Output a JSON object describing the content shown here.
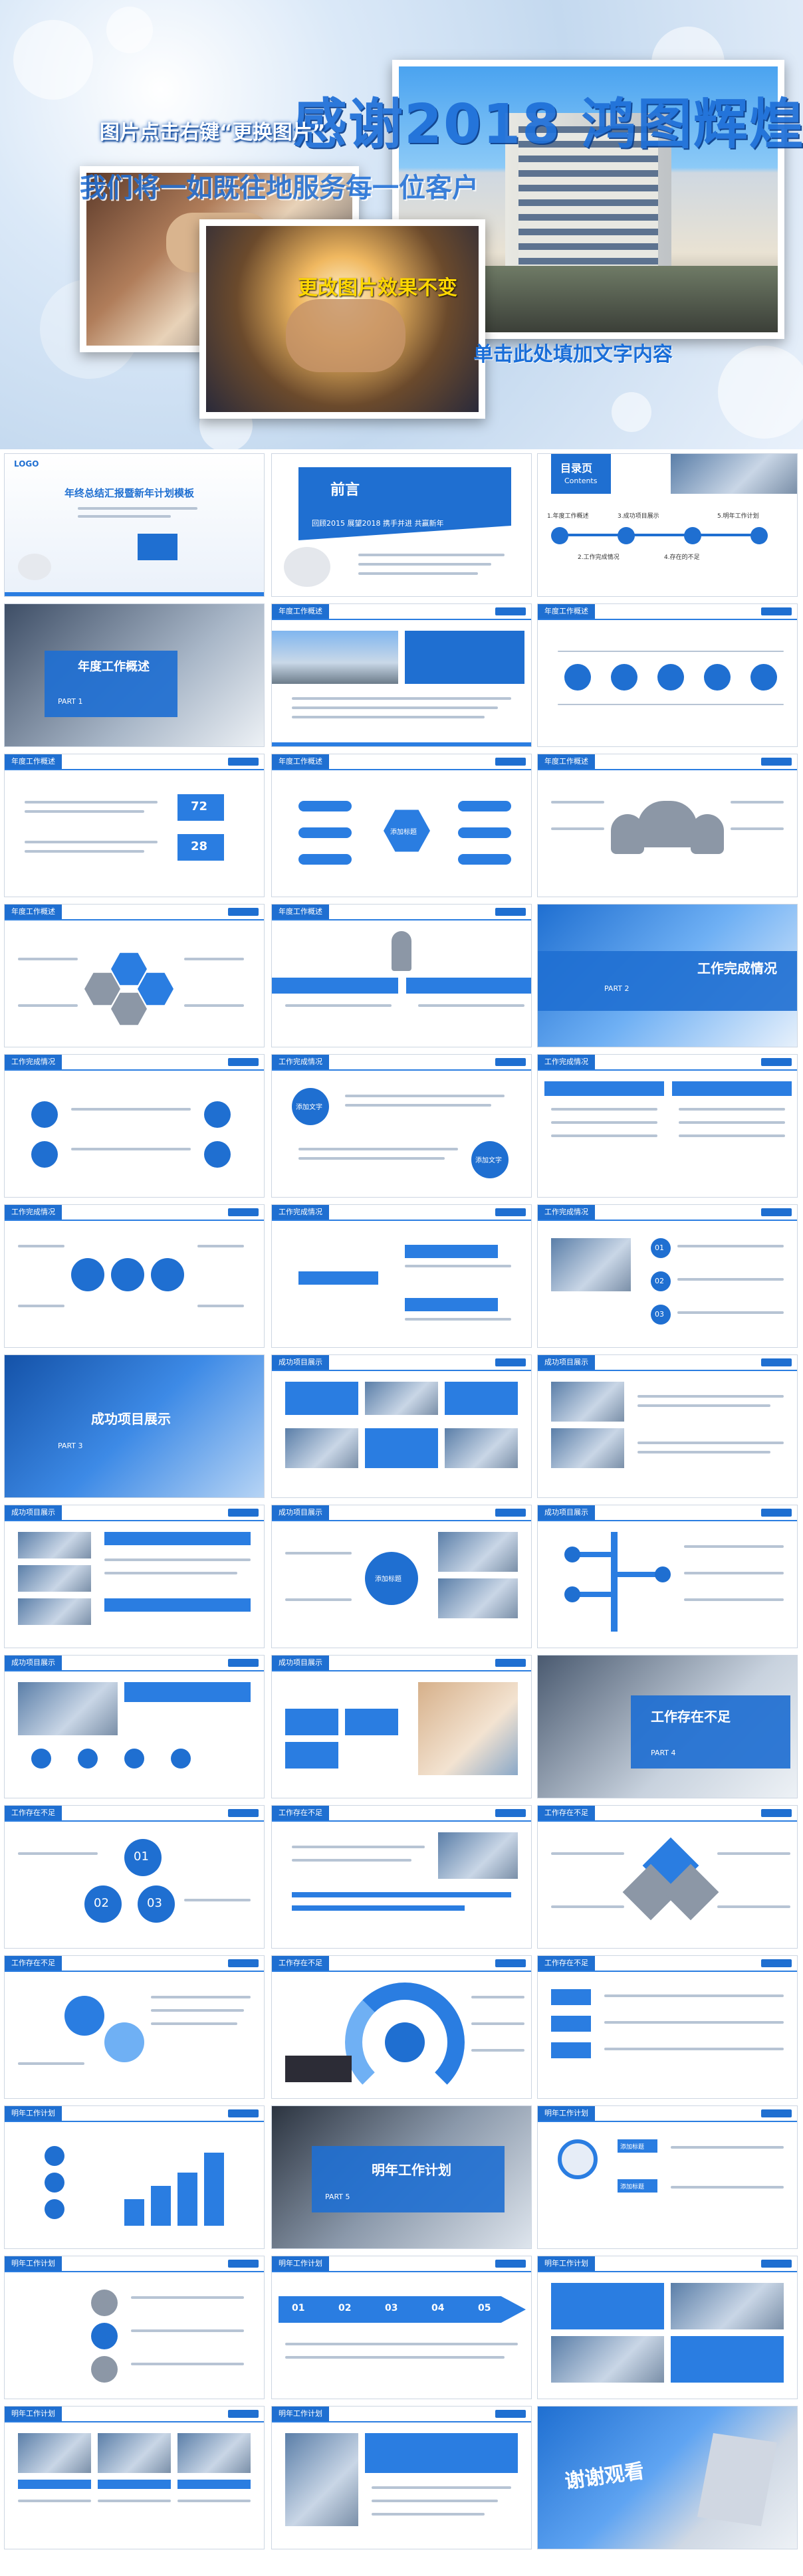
{
  "hero": {
    "title": "感谢2018 鸿图辉煌",
    "hint": "图片点击右键“更换图片”",
    "subtitle": "我们将一如既往地服务每一位客户",
    "tip": "更改图片效果不变",
    "caption": "单击此处填加文字内容"
  },
  "slides": {
    "cover": {
      "title": "年终总结汇报暨新年计划模板",
      "logo": "LOGO"
    },
    "preface": {
      "title": "前言",
      "sub": "回顾2015 展望2018 携手并进 共赢新年"
    },
    "contents": {
      "title": "目录页",
      "sub": "Contents",
      "items": [
        "1.年度工作概述",
        "2.工作完成情况",
        "3.成功项目展示",
        "4.存在的不足",
        "5.明年工作计划"
      ]
    },
    "part1": {
      "title": "年度工作概述",
      "tag": "PART 1"
    },
    "part2": {
      "title": "工作完成情况",
      "tag": "PART 2"
    },
    "part3": {
      "title": "成功项目展示",
      "tag": "PART 3"
    },
    "part4": {
      "title": "工作存在不足",
      "tag": "PART 4"
    },
    "part5": {
      "title": "明年工作计划",
      "tag": "PART 5"
    },
    "thanks": {
      "title": "谢谢观看"
    },
    "labels": {
      "overview": "年度工作概述",
      "done": "工作完成情况",
      "projects": "成功项目展示",
      "shortcomings": "工作存在不足",
      "plan": "明年工作计划",
      "add_title": "添加标题",
      "add_text": "添加文字",
      "percent1": "72",
      "percent2": "28",
      "n01": "01",
      "n02": "02",
      "n03": "03",
      "steps": [
        "01",
        "02",
        "03",
        "04",
        "05"
      ]
    }
  },
  "colors": {
    "accent": "#1f6fd1",
    "accent_light": "#2a7de1",
    "bg": "#f2f5f9"
  }
}
